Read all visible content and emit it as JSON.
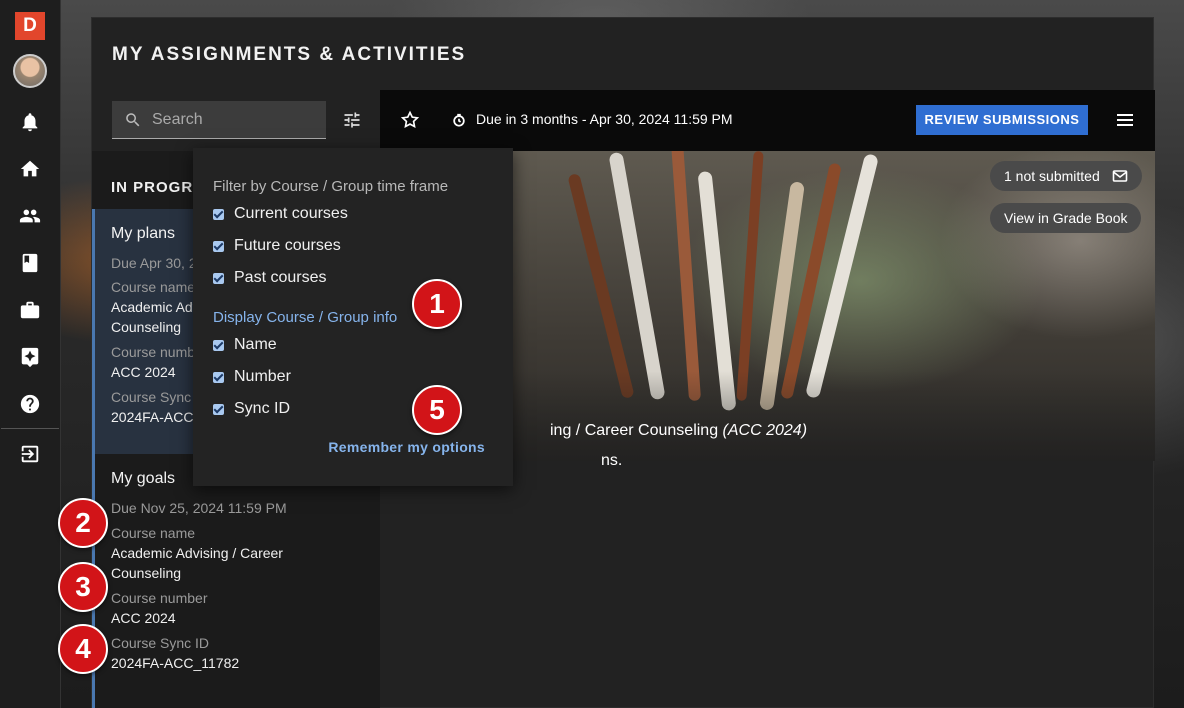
{
  "rail": {
    "logo": "D",
    "icons": [
      "bell-icon",
      "home-icon",
      "people-icon",
      "book-icon",
      "briefcase-icon",
      "sparkle-icon",
      "help-icon",
      "logout-icon"
    ]
  },
  "page": {
    "title": "MY ASSIGNMENTS & ACTIVITIES"
  },
  "search": {
    "placeholder": "Search"
  },
  "list": {
    "header": "IN PROGRE",
    "items": [
      {
        "title": "My plans",
        "due": "Due Apr 30, 2",
        "course_name_label": "Course name",
        "course_name": "Academic Advis",
        "course_name_2": "Counseling",
        "course_number_label": "Course numb",
        "course_number": "ACC 2024",
        "sync_label": "Course Sync",
        "sync_id": "2024FA-ACC"
      },
      {
        "title": "My goals",
        "due": "Due Nov 25, 2024 11:59 PM",
        "course_name_label": "Course name",
        "course_name": "Academic Advising / Career",
        "course_name_2": "Counseling",
        "course_number_label": "Course number",
        "course_number": "ACC 2024",
        "sync_label": "Course Sync ID",
        "sync_id": "2024FA-ACC_11782"
      }
    ]
  },
  "topbar": {
    "due_text": "Due in 3 months - Apr 30, 2024 11:59 PM",
    "review_label": "REVIEW SUBMISSIONS"
  },
  "hero": {
    "not_submitted": "1 not submitted",
    "grade_book": "View in Grade Book",
    "course_line": "ing / Career Counseling",
    "course_code": "(ACC 2024)",
    "line2": "ns."
  },
  "dropdown": {
    "filter_heading": "Filter by Course / Group time frame",
    "filter_options": [
      "Current courses",
      "Future courses",
      "Past courses"
    ],
    "display_heading": "Display Course / Group info",
    "display_options": [
      "Name",
      "Number",
      "Sync ID"
    ],
    "remember_label": "Remember my options"
  },
  "callouts": [
    "1",
    "2",
    "3",
    "4",
    "5"
  ],
  "colors": {
    "accent": "#2f6ed2",
    "callout": "#d21418",
    "logo": "#e2462c",
    "link": "#86b4ec"
  }
}
